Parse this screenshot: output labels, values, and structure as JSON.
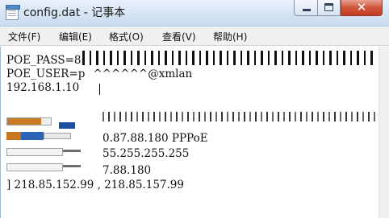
{
  "window": {
    "title": "config.dat - 记事本",
    "close_glyph": "✕",
    "icons": [
      "notepad-icon",
      "minimize-icon",
      "maximize-icon",
      "close-icon"
    ]
  },
  "menu": {
    "items": [
      "文件(F)",
      "编辑(E)",
      "格式(O)",
      "查看(V)",
      "帮助(H)"
    ]
  },
  "editor": {
    "lines": [
      "POE_PASS=8",
      "POE_USER=p",
      "192.168.1.10",
      "",
      "0.87.88.180 PPPoE",
      "55.255.255.255",
      "7.88.180",
      "]          218.85.152.99 , 218.85.157.99"
    ],
    "user_suffix": "^^^^^^@xmlan"
  },
  "colors": {
    "title_bar": "#d8e6f4",
    "close_button": "#c43c23",
    "menu_bar": "#f0f0f0",
    "text": "#111111",
    "redaction_blue": "#1d4e9f",
    "redaction_orange": "#c97a25"
  }
}
